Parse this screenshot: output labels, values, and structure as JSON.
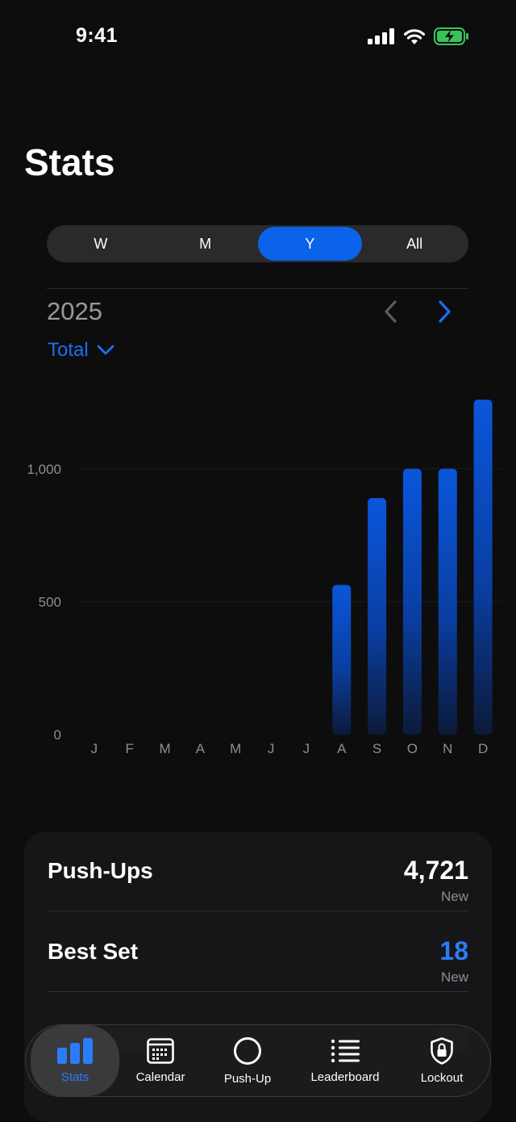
{
  "status_bar": {
    "time": "9:41"
  },
  "header": {
    "title": "Stats"
  },
  "period_tabs": [
    {
      "label": "W",
      "selected": false
    },
    {
      "label": "M",
      "selected": false
    },
    {
      "label": "Y",
      "selected": true
    },
    {
      "label": "All",
      "selected": false
    }
  ],
  "period": {
    "year": "2025",
    "metric": "Total"
  },
  "chart_data": {
    "type": "bar",
    "categories": [
      "J",
      "F",
      "M",
      "A",
      "M",
      "J",
      "J",
      "A",
      "S",
      "O",
      "N",
      "D"
    ],
    "values": [
      0,
      0,
      0,
      0,
      0,
      0,
      0,
      563,
      890,
      1000,
      1000,
      1260
    ],
    "ylim": [
      0,
      1300
    ],
    "yticks": [
      "0",
      "500",
      "1,000"
    ],
    "ytick_values": [
      0,
      500,
      1000
    ],
    "grid": true,
    "bar_color": "#0a5ce0"
  },
  "stats": [
    {
      "label": "Push-Ups",
      "value": "4,721",
      "sub": "New",
      "accent": false
    },
    {
      "label": "Best Set",
      "value": "18",
      "sub": "New",
      "accent": true
    }
  ],
  "accent_color": "#1a6ff0",
  "tab_bar": {
    "items": [
      {
        "label": "Stats",
        "icon": "bar-chart-icon",
        "selected": true
      },
      {
        "label": "Calendar",
        "icon": "calendar-icon",
        "selected": false
      },
      {
        "label": "Push-Up",
        "icon": "circle-icon",
        "selected": false
      },
      {
        "label": "Leaderboard",
        "icon": "list-icon",
        "selected": false
      },
      {
        "label": "Lockout",
        "icon": "lock-shield-icon",
        "selected": false
      }
    ]
  }
}
